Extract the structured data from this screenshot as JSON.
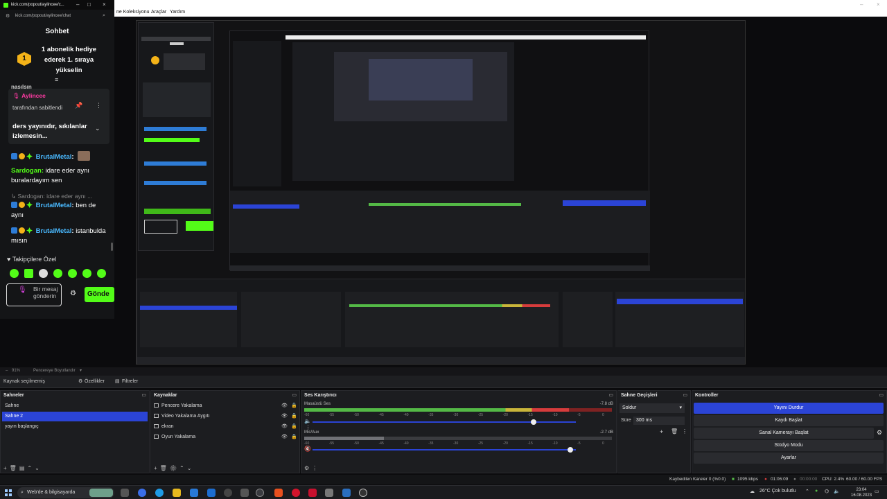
{
  "menubar": {
    "items": [
      "ne Koleksiyonu",
      "Araçlar",
      "Yardım"
    ]
  },
  "chat_window": {
    "title": "kick.com/popout/aylincee/c...",
    "url": "kick.com/popout/aylincee/chat",
    "heading": "Sohbet",
    "gift_level": "1",
    "gift_text": "1 abonelik hediye ederek 1. sıraya yükselin",
    "partial_user": "nasılsın",
    "pinned": {
      "user": "Aylincee",
      "by_label": "tarafından sabitlendi",
      "message": "ders yayınıdır, sıkılanlar izlemesin..."
    },
    "messages": [
      {
        "user": "BrutalMetal",
        "text": ""
      },
      {
        "user": "Sardogan",
        "text": "idare eder aynı buralardayım sen"
      },
      {
        "reply_to": "Sardogan: idare eder aynı ..."
      },
      {
        "user": "BrutalMetal",
        "text": "ben de aynı"
      },
      {
        "user": "BrutalMetal",
        "text": "istanbulda mısın"
      }
    ],
    "followers_label": "Takipçilere Özel",
    "input_placeholder": "Bir mesaj gönderin",
    "send_label": "Gönde"
  },
  "obs": {
    "zoom": "91%",
    "zoom_mode": "Pencereye Boyutlandır",
    "no_source": "Kaynak seçilmemiş",
    "properties": "Özellikler",
    "filters": "Filtreler",
    "scenes": {
      "title": "Sahneler",
      "items": [
        {
          "label": "Sahne",
          "selected": false
        },
        {
          "label": "Sahne 2",
          "selected": true
        },
        {
          "label": "yayın başlangıç",
          "selected": false
        }
      ]
    },
    "sources": {
      "title": "Kaynaklar",
      "items": [
        "Pencere Yakalama",
        "Video Yakalama Aygıtı",
        "ekran",
        "Oyun Yakalama"
      ]
    },
    "mixer": {
      "title": "Ses Karıştırıcı",
      "channels": [
        {
          "name": "Masaüstü Ses",
          "db": "-7.8 dB",
          "level": 0.86,
          "volume": 0.84
        },
        {
          "name": "Mic/Aux",
          "db": "-2.7 dB",
          "level": 0.26,
          "volume": 0.98
        }
      ],
      "ticks": [
        "-60",
        "-55",
        "-50",
        "-45",
        "-40",
        "-35",
        "-30",
        "-25",
        "-20",
        "-15",
        "-10",
        "-5",
        "0"
      ]
    },
    "transitions": {
      "title": "Sahne Geçişleri",
      "selected": "Soldur",
      "duration_label": "Süre",
      "duration": "300 ms"
    },
    "controls": {
      "title": "Kontroller",
      "buttons": [
        "Yayını Durdur",
        "Kaydı Başlat",
        "Sanal Kamerayı Başlat",
        "Stüdyo Modu",
        "Ayarlar"
      ]
    },
    "status": {
      "dropped": "Kaybedilen Kareler 0 (%0.0)",
      "bitrate": "1095 kbps",
      "live_time": "01:06:09",
      "rec_time": "00:00:00",
      "cpu": "CPU: 2.4%",
      "fps": "60.00 / 60.00 FPS"
    }
  },
  "taskbar": {
    "search_placeholder": "Web'de & bilgisayarda",
    "weather": "26°C  Çok bulutlu",
    "time": "23:04",
    "date": "16.08.2023"
  },
  "colors": {
    "kick_green": "#53fc18",
    "obs_blue": "#2b44d6"
  }
}
